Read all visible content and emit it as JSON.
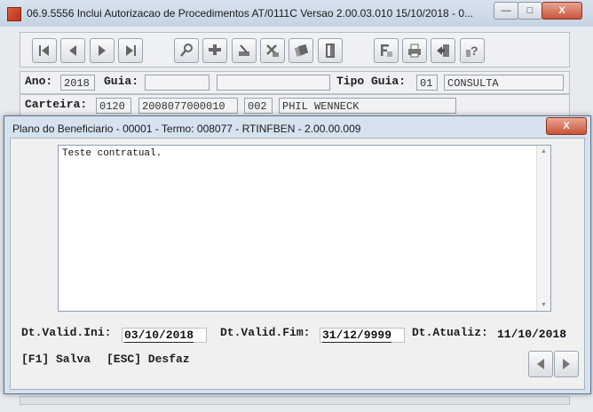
{
  "main_window": {
    "title": "06.9.5556   Inclui  Autorizacao de Procedimentos AT/0111C Versao 2.00.03.010 15/10/2018 - 0...",
    "min_glyph": "—",
    "max_glyph": "□",
    "close_glyph": "X"
  },
  "form": {
    "ano_label": "Ano:",
    "ano_value": "2018",
    "guia_label": "Guia:",
    "guia_value": "",
    "guia_value2": "",
    "tipo_guia_label": "Tipo Guia:",
    "tipo_guia_code": "01",
    "tipo_guia_desc": "CONSULTA",
    "carteira_label": "Carteira:",
    "carteira_op": "0120",
    "carteira_num": "2008077000010",
    "carteira_seq": "002",
    "beneficiario_nome": "PHIL WENNECK"
  },
  "toolbar_icons": [
    "first-record-icon",
    "previous-record-icon",
    "next-record-icon",
    "last-record-icon",
    "search-key-icon",
    "add-icon",
    "edit-icon",
    "delete-icon",
    "copy-icon",
    "exit-door-icon",
    "filter-icon",
    "print-icon",
    "export-icon",
    "help-icon"
  ],
  "dialog": {
    "title": "Plano do Beneficiario - 00001 - Termo: 008077 - RTINFBEN - 2.00.00.009",
    "close_glyph": "X",
    "memo_text": "Teste contratual.",
    "dt_valid_ini_label": "Dt.Valid.Ini:",
    "dt_valid_ini_value": "03/10/2018",
    "dt_valid_fim_label": "Dt.Valid.Fim:",
    "dt_valid_fim_value": "31/12/9999",
    "dt_atualiz_label": "Dt.Atualiz:",
    "dt_atualiz_value": "11/10/2018",
    "hint_save": "[F1] Salva",
    "hint_undo": "[ESC] Desfaz"
  }
}
